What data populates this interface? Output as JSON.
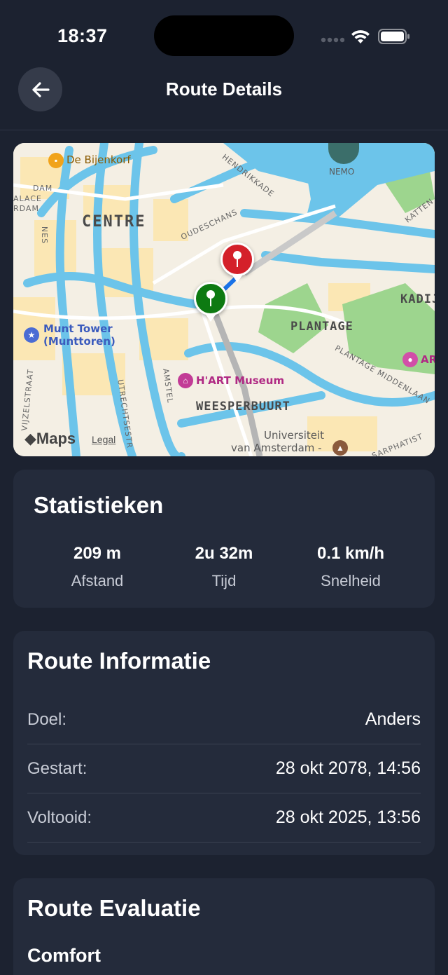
{
  "status_bar": {
    "time": "18:37"
  },
  "nav": {
    "title": "Route Details"
  },
  "map": {
    "labels": {
      "de_bijenkorf": "De Bijenkorf",
      "centre": "CENTRE",
      "nemo": "NEMO",
      "hendrikkade": "HENDRIKKADE",
      "oudeschans": "OUDESCHANS",
      "dam": "DAM",
      "palace": "ALACE",
      "rdam": "RDAM",
      "nes": "NES",
      "munt_tower_1": "Munt Tower",
      "munt_tower_2": "(Munttoren)",
      "plantage": "PLANTAGE",
      "kadij": "KADIJ",
      "katten": "KATTEN",
      "plantage_middenlaan": "PLANTAGE MIDDENLAAN",
      "hart_museum": "H'ART Museum",
      "weesperbuurt": "WEESPERBUURT",
      "amstel": "AMSTEL",
      "utrechtsestr": "UTRECHTSESTR",
      "vijzelstraat": "VIJZELSTRAAT",
      "universiteit_1": "Universiteit",
      "universiteit_2": "van Amsterdam -",
      "sarphatist": "SARPHATIST",
      "artis": "AR",
      "maps": "Maps",
      "legal": "Legal"
    }
  },
  "stats": {
    "title": "Statistieken",
    "items": [
      {
        "value": "209 m",
        "label": "Afstand"
      },
      {
        "value": "2u 32m",
        "label": "Tijd"
      },
      {
        "value": "0.1 km/h",
        "label": "Snelheid"
      }
    ]
  },
  "route_info": {
    "title": "Route Informatie",
    "rows": [
      {
        "label": "Doel:",
        "value": "Anders"
      },
      {
        "label": "Gestart:",
        "value": "28 okt 2078, 14:56"
      },
      {
        "label": "Voltooid:",
        "value": "28 okt 2025, 13:56"
      }
    ]
  },
  "evaluation": {
    "title": "Route Evaluatie",
    "subtitle": "Comfort"
  },
  "colors": {
    "background": "#1c2230",
    "card": "#242b3b",
    "start_pin": "#0d7a12",
    "end_pin": "#d4202a",
    "route_line": "#1a73e8"
  }
}
